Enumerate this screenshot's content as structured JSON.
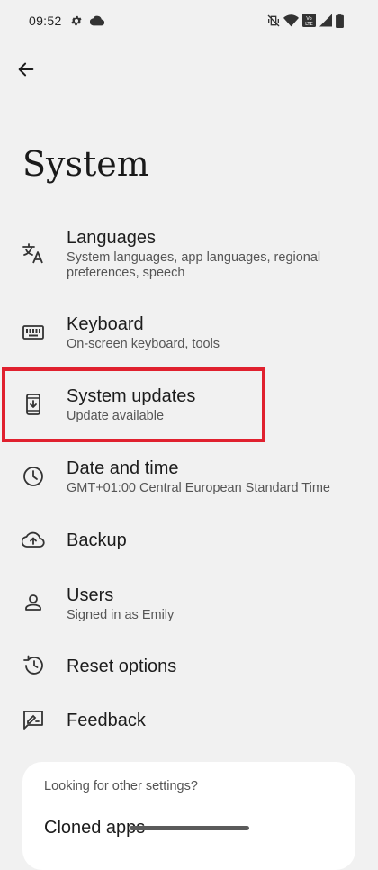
{
  "status_bar": {
    "time": "09:52",
    "left_icons": [
      "gear-icon",
      "cloud-icon"
    ],
    "right_icons": [
      "vibrate-off-icon",
      "wifi-icon",
      "volte-icon",
      "signal-icon",
      "battery-icon"
    ],
    "volte_text": "Vo LTE"
  },
  "header": {
    "back_icon": "arrow-left-icon",
    "title": "System"
  },
  "items": [
    {
      "icon": "translate-icon",
      "title": "Languages",
      "subtitle": "System languages, app languages, regional preferences, speech"
    },
    {
      "icon": "keyboard-icon",
      "title": "Keyboard",
      "subtitle": "On-screen keyboard, tools"
    },
    {
      "icon": "system-update-icon",
      "title": "System updates",
      "subtitle": "Update available"
    },
    {
      "icon": "clock-icon",
      "title": "Date and time",
      "subtitle": "GMT+01:00 Central European Standard Time"
    },
    {
      "icon": "cloud-upload-icon",
      "title": "Backup",
      "subtitle": ""
    },
    {
      "icon": "person-icon",
      "title": "Users",
      "subtitle": "Signed in as Emily"
    },
    {
      "icon": "history-icon",
      "title": "Reset options",
      "subtitle": ""
    },
    {
      "icon": "feedback-icon",
      "title": "Feedback",
      "subtitle": ""
    }
  ],
  "other_settings": {
    "header": "Looking for other settings?",
    "items": [
      "Cloned apps"
    ]
  },
  "colors": {
    "background": "#f1f1f1",
    "highlight": "#e0202e",
    "card": "#ffffff"
  }
}
